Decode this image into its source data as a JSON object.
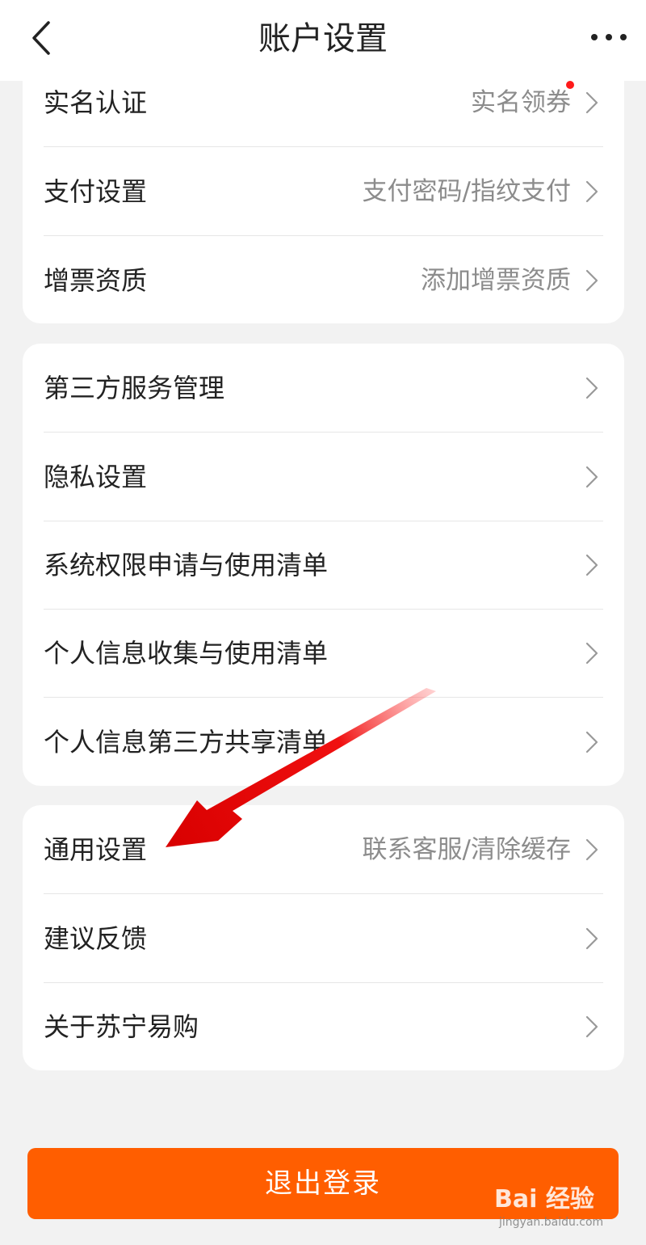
{
  "header": {
    "title": "账户设置"
  },
  "icons": {
    "back": "chevron-left-icon",
    "more": "more-horizontal-icon",
    "row_arrow": "chevron-right-icon"
  },
  "groups": [
    {
      "items": [
        {
          "label": "实名认证",
          "value": "实名领券",
          "badge": true
        },
        {
          "label": "支付设置",
          "value": "支付密码/指纹支付"
        },
        {
          "label": "增票资质",
          "value": "添加增票资质"
        }
      ]
    },
    {
      "items": [
        {
          "label": "第三方服务管理",
          "value": ""
        },
        {
          "label": "隐私设置",
          "value": ""
        },
        {
          "label": "系统权限申请与使用清单",
          "value": ""
        },
        {
          "label": "个人信息收集与使用清单",
          "value": ""
        },
        {
          "label": "个人信息第三方共享清单",
          "value": ""
        }
      ]
    },
    {
      "items": [
        {
          "label": "通用设置",
          "value": "联系客服/清除缓存"
        },
        {
          "label": "建议反馈",
          "value": ""
        },
        {
          "label": "关于苏宁易购",
          "value": ""
        }
      ]
    }
  ],
  "logout": {
    "label": "退出登录"
  },
  "watermark": {
    "text": "Bai 经验",
    "url_text": "jingyan.baidu.com"
  },
  "colors": {
    "accent": "#ff5e00",
    "badge": "#ff1a1a",
    "annotation_arrow": "#ee0000"
  }
}
